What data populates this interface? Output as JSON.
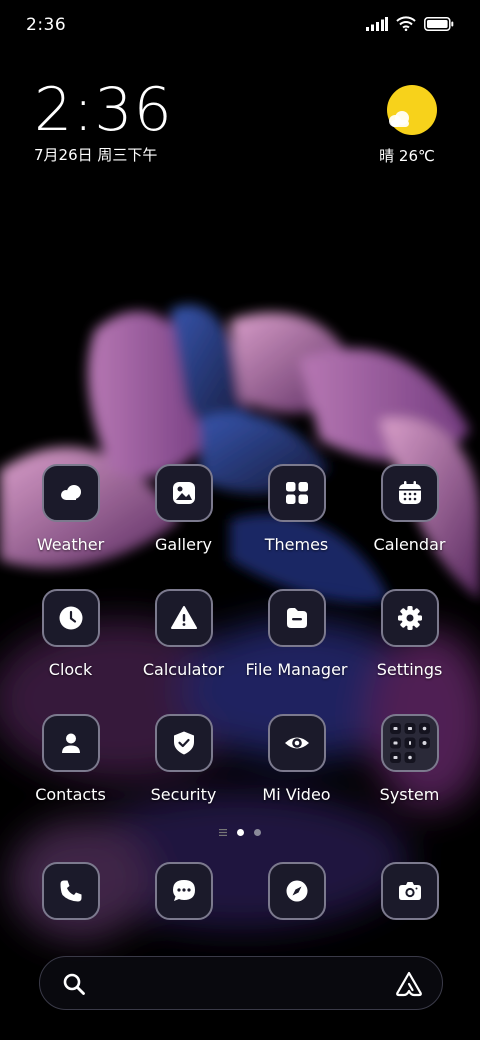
{
  "status_bar": {
    "time": "2:36"
  },
  "clock_widget": {
    "time": "2:36",
    "date": "7月26日 周三下午"
  },
  "weather_widget": {
    "text": "晴 26℃"
  },
  "apps": [
    [
      {
        "label": "Weather",
        "icon": "weather-icon"
      },
      {
        "label": "Gallery",
        "icon": "gallery-icon"
      },
      {
        "label": "Themes",
        "icon": "themes-icon"
      },
      {
        "label": "Calendar",
        "icon": "calendar-icon"
      }
    ],
    [
      {
        "label": "Clock",
        "icon": "clock-icon"
      },
      {
        "label": "Calculator",
        "icon": "calculator-icon"
      },
      {
        "label": "File Manager",
        "icon": "file-manager-icon"
      },
      {
        "label": "Settings",
        "icon": "settings-icon"
      }
    ],
    [
      {
        "label": "Contacts",
        "icon": "contacts-icon"
      },
      {
        "label": "Security",
        "icon": "security-icon"
      },
      {
        "label": "Mi Video",
        "icon": "mi-video-icon"
      },
      {
        "label": "System",
        "icon": "system-folder-icon"
      }
    ]
  ],
  "dock": [
    {
      "icon": "phone-icon"
    },
    {
      "icon": "messages-icon"
    },
    {
      "icon": "browser-icon"
    },
    {
      "icon": "camera-icon"
    }
  ],
  "pager": {
    "page_count": 2,
    "active_page": 1
  },
  "colors": {
    "icon_bg": "#1b1a2a",
    "icon_border": "#7c7a8e",
    "sun": "#f7d21b"
  }
}
